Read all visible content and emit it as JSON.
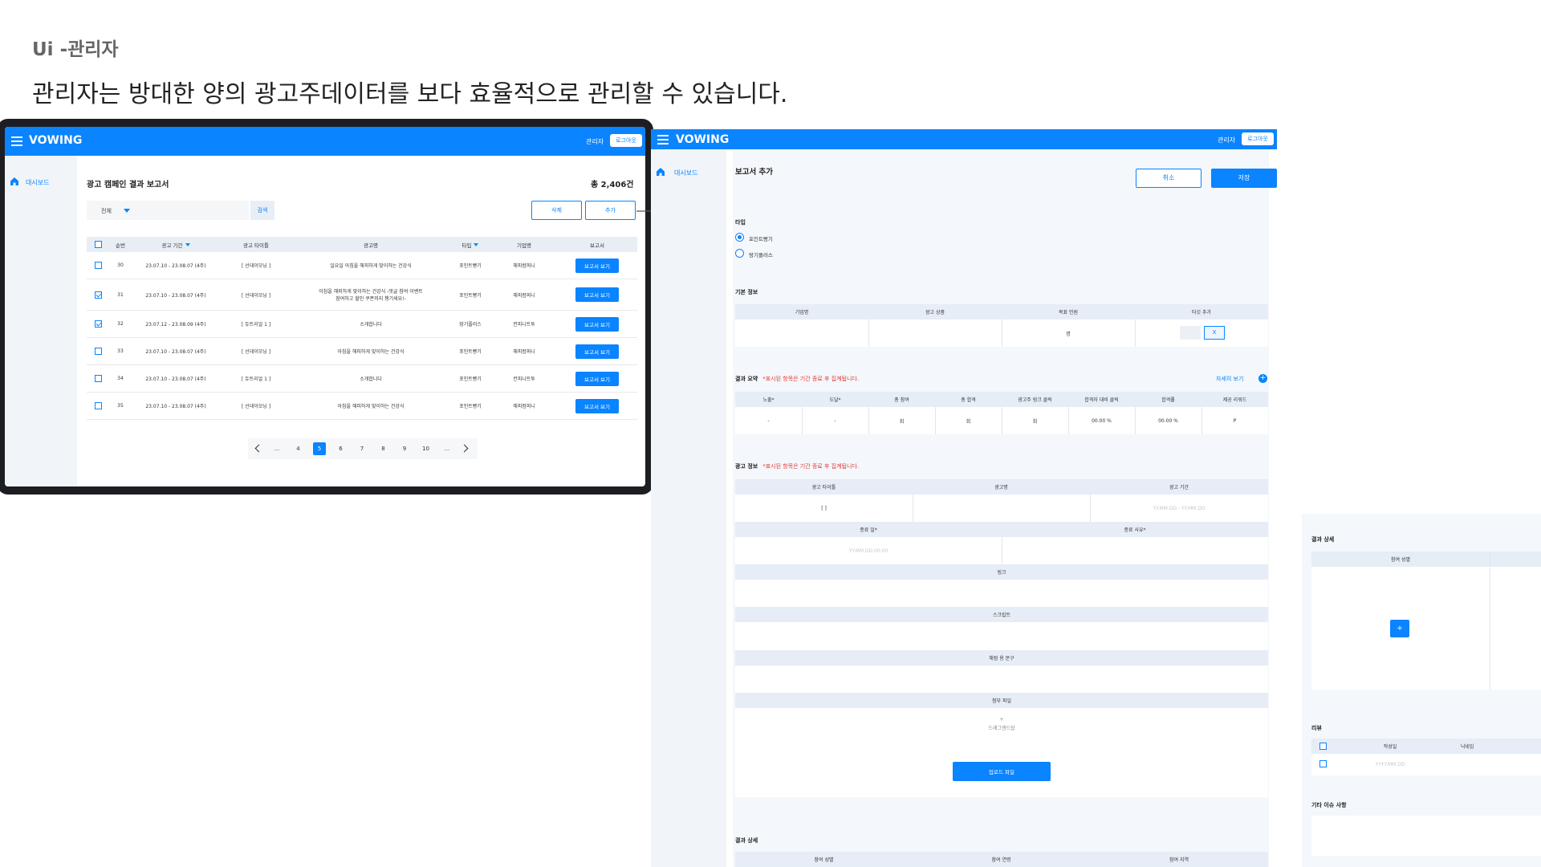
{
  "caption": "Ui -관리자",
  "headline": "관리자는 방대한 양의 광고주데이터를 보다 효율적으로 관리할 수 있습니다.",
  "brand": "VOWING",
  "header": {
    "admin_label": "관리자",
    "logout_label": "로그아웃"
  },
  "sidebar": {
    "dashboard_label": "대시보드"
  },
  "report_list": {
    "title": "광고 캠페인 결과 보고서",
    "total": "총 2,406건",
    "filter_selected": "전체",
    "search_label": "검색",
    "delete_label": "삭제",
    "add_label": "추가",
    "columns": [
      "순번",
      "광고 기간",
      "광고 타이틀",
      "광고명",
      "타입",
      "기업명",
      "보고서"
    ],
    "rows": [
      {
        "checked": false,
        "no": "30",
        "period": "23.07.10 - 23.08.07 (4주)",
        "title": "[ 선데이모닝 ]",
        "name": "일요일 아침을 해피하게 맞이하는 건강식",
        "type": "포인트빵기",
        "company": "해피컴퍼니",
        "btn": "보고서 보기"
      },
      {
        "checked": true,
        "no": "31",
        "period": "23.07.10 - 23.08.07 (4주)",
        "title": "[ 선데이모닝 ]",
        "name": "아침을 해피하게 맞이하는 건강식 -댓글 참여 이벤트 참여하고 할인 쿠폰까지 챙기세요!-",
        "type": "포인트빵기",
        "company": "해피컴퍼니",
        "btn": "보고서 보기"
      },
      {
        "checked": true,
        "no": "32",
        "period": "23.07.12 - 23.08.09 (4주)",
        "title": "[ 듀트리얼 1 ]",
        "name": "소개합니다",
        "type": "땅기플러스",
        "company": "컨피니트투",
        "btn": "보고서 보기"
      },
      {
        "checked": false,
        "no": "33",
        "period": "23.07.10 - 23.08.07 (4주)",
        "title": "[ 선데이모닝 ]",
        "name": "아침을 해피하게 맞이하는 건강식",
        "type": "포인트빵기",
        "company": "해피컴퍼니",
        "btn": "보고서 보기"
      },
      {
        "checked": false,
        "no": "34",
        "period": "23.07.10 - 23.08.07 (4주)",
        "title": "[ 듀트리얼 1 ]",
        "name": "소개합니다",
        "type": "포인트빵기",
        "company": "컨피니트투",
        "btn": "보고서 보기"
      },
      {
        "checked": false,
        "no": "35",
        "period": "23.07.10 - 23.08.07 (4주)",
        "title": "[ 선데이모닝 ]",
        "name": "아침을 해피하게 맞이하는 건강식",
        "type": "포인트빵기",
        "company": "해피컴퍼니",
        "btn": "보고서 보기"
      }
    ],
    "pagination": {
      "items": [
        "...",
        "4",
        "5",
        "6",
        "7",
        "8",
        "9",
        "10",
        "..."
      ],
      "current": "5"
    }
  },
  "report_add": {
    "breadcrumb": "보고서 추가",
    "cancel_label": "취소",
    "save_label": "저장",
    "type_section": "타입",
    "type_options": [
      "포인트빵기",
      "땅기플러스"
    ],
    "type_selected": "포인트빵기",
    "basic_section": "기본 정보",
    "basic_headers": [
      "기업명",
      "광고 상품",
      "목표 인원",
      "타깃 추가"
    ],
    "basic_unit": "명",
    "basic_remove": "X",
    "summary_section": "결과 요약",
    "summary_note": "*표시된 항목은 기간 종료 후 집계됩니다.",
    "summary_more": "자세히 보기",
    "summary_headers": [
      "노출*",
      "도달*",
      "총 참여",
      "총 합격",
      "광고주 링크 클릭",
      "합격자 대비 클릭",
      "합격률",
      "제공 리워드"
    ],
    "summary_values": [
      "-",
      "-",
      "회",
      "회",
      "회",
      "00.00  %",
      "00.00  %",
      "P"
    ],
    "adinfo_section": "광고 정보",
    "adinfo_note": "*표시된 항목은 기간 종료 후 집계됩니다.",
    "adinfo_headers": [
      "광고 타이틀",
      "광고명",
      "광고 기간"
    ],
    "adinfo_title_value": "[      ]",
    "adinfo_period_placeholder": "YY.MM.DD - YY.MM.DD",
    "end_headers": [
      "종료 일*",
      "종료 사유*"
    ],
    "end_date_placeholder": "YY.MM.DD.00:00",
    "link_label": "링크",
    "script_label": "스크립트",
    "copy_label": "채점 용 문구",
    "attach_label": "첨부 파일",
    "drag_label": "드래그앤드랍",
    "upload_label": "업로드 파일",
    "detail_section": "결과 상세",
    "detail_headers": [
      "참여 성별",
      "참여 연령",
      "참여 지역"
    ]
  },
  "report_detail": {
    "detail_section": "결과 상세",
    "detail_header": "참여 성별",
    "add_symbol": "+",
    "review_section": "리뷰",
    "review_headers": [
      "작성일",
      "닉네임"
    ],
    "review_date_placeholder": "YYYY.MM.DD",
    "other_section": "기타 이슈 사항"
  },
  "colors": {
    "primary": "#0a84ff",
    "frame": "#1e1e22",
    "panel": "#f4f7fb",
    "table_head": "#e9eef5",
    "note": "#e53935"
  }
}
